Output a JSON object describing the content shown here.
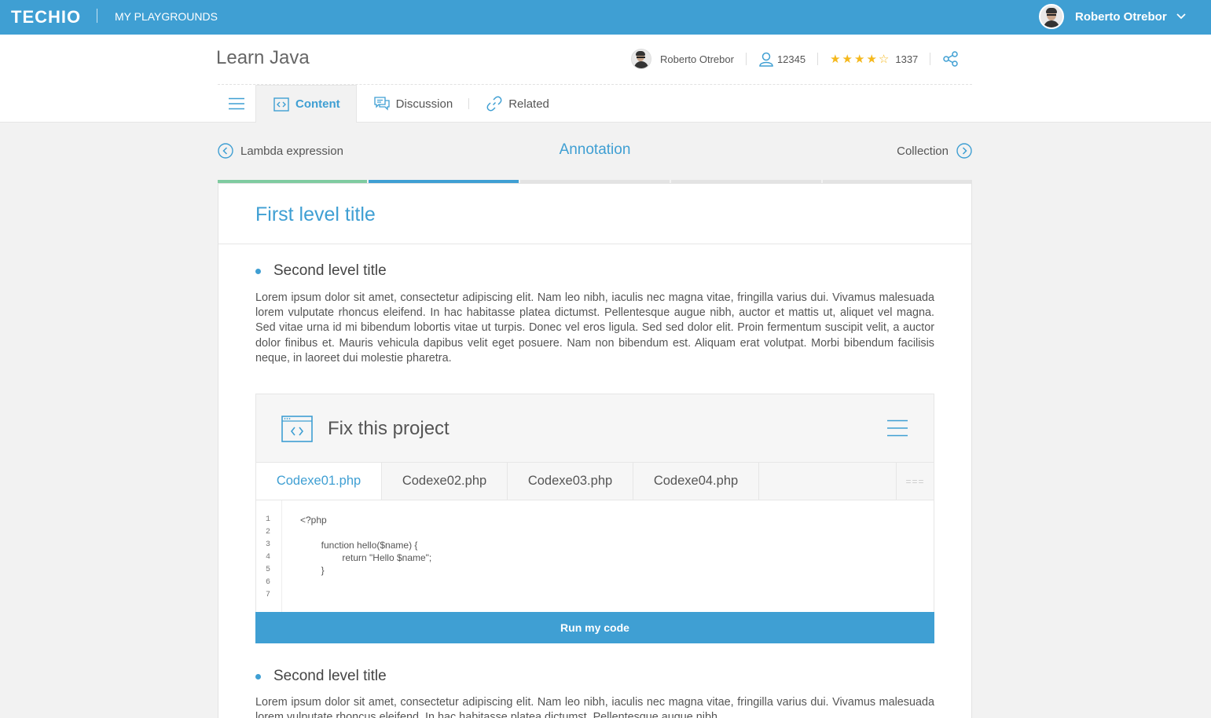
{
  "topbar": {
    "logo": "TECHIO",
    "playgrounds_link": "MY PLAYGROUNDS",
    "user_name": "Roberto Otrebor",
    "avatar_icon": "user-avatar",
    "dropdown_icon": "chevron-down-icon"
  },
  "course": {
    "title": "Learn Java",
    "author": "Roberto Otrebor",
    "followers": "12345",
    "rating_stars": 4,
    "rating_max": 5,
    "rating_count": "1337",
    "share_icon": "share-icon"
  },
  "tabs": [
    {
      "label": "Content",
      "icon": "code-window-icon",
      "active": true
    },
    {
      "label": "Discussion",
      "icon": "chat-bubbles-icon",
      "active": false
    },
    {
      "label": "Related",
      "icon": "link-icon",
      "active": false
    }
  ],
  "lesson_nav": {
    "previous": "Lambda expression",
    "current": "Annotation",
    "next": "Collection"
  },
  "progress": {
    "segments": 5,
    "completed": 1,
    "current_index": 1,
    "colors": {
      "completed": "#7fcba0",
      "current": "#3f9fd3",
      "upcoming": "#e3e3e3"
    }
  },
  "content": {
    "h1": "First level title",
    "sections": [
      {
        "title": "Second level title",
        "text": "Lorem ipsum dolor sit amet, consectetur adipiscing elit. Nam leo nibh, iaculis nec magna vitae, fringilla varius dui. Vivamus malesuada lorem vulputate rhoncus eleifend. In hac habitasse platea dictumst. Pellentesque augue nibh, auctor et mattis ut, aliquet vel magna. Sed vitae urna id mi bibendum lobortis vitae ut turpis. Donec vel eros ligula. Sed sed dolor elit. Proin fermentum suscipit velit, a auctor dolor finibus et. Mauris vehicula dapibus velit eget posuere. Nam non bibendum est. Aliquam erat volutpat. Morbi bibendum facilisis neque, in laoreet dui molestie pharetra."
      },
      {
        "title": "Second level title",
        "text": "Lorem ipsum dolor sit amet, consectetur adipiscing elit. Nam leo nibh, iaculis nec magna vitae, fringilla varius dui. Vivamus malesuada lorem vulputate rhoncus eleifend. In hac habitasse platea dictumst. Pellentesque augue nibh"
      }
    ]
  },
  "widget": {
    "title": "Fix this project",
    "files": [
      "Codexe01.php",
      "Codexe02.php",
      "Codexe03.php",
      "Codexe04.php"
    ],
    "active_file": 0,
    "more_label": "===",
    "line_numbers": [
      "1",
      "2",
      "3",
      "4",
      "5",
      "6",
      "7"
    ],
    "code": [
      "<?php",
      "",
      "        function hello($name) {",
      "                return \"Hello $name\";",
      "        }",
      "",
      ""
    ],
    "run_label": "Run my code"
  },
  "colors": {
    "accent": "#3f9fd3",
    "star": "#f5b81c",
    "progress_done": "#7fcba0"
  }
}
